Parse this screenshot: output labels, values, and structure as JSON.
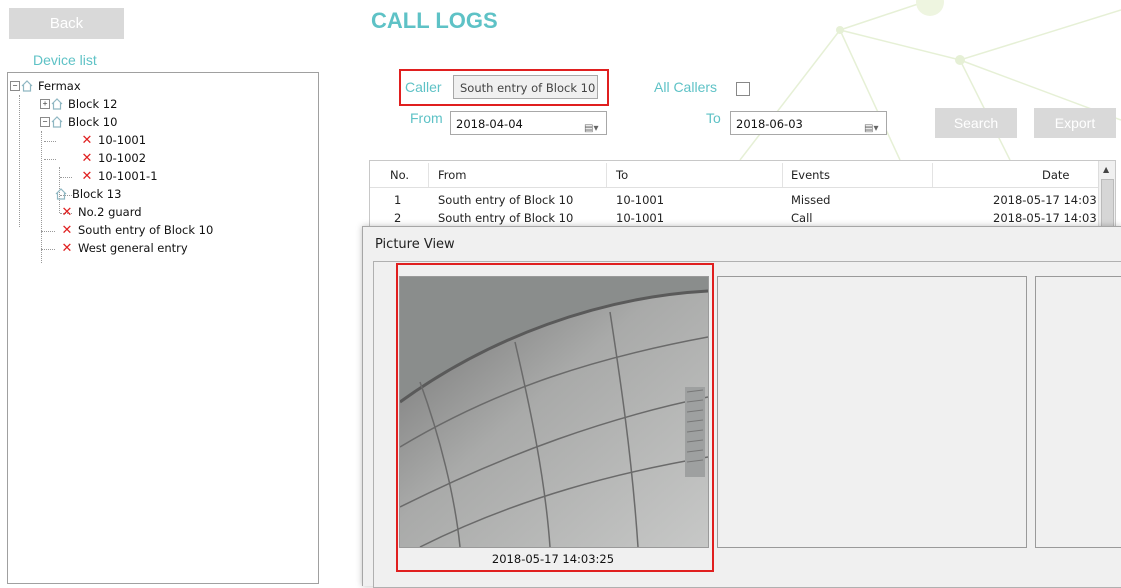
{
  "sidebar": {
    "back_label": "Back",
    "device_list_label": "Device list",
    "tree": [
      {
        "label": "Fermax",
        "icon": "house-icon",
        "expander": "−"
      },
      {
        "label": "Block 12",
        "icon": "house-icon",
        "expander": "+"
      },
      {
        "label": "Block 10",
        "icon": "house-icon",
        "expander": "−"
      },
      {
        "label": "10-1001",
        "icon": "offline-x-icon"
      },
      {
        "label": "10-1002",
        "icon": "offline-x-icon"
      },
      {
        "label": "10-1001-1",
        "icon": "offline-x-icon"
      },
      {
        "label": "Block 13",
        "icon": "house-icon"
      },
      {
        "label": "No.2 guard",
        "icon": "offline-x-icon"
      },
      {
        "label": "South entry of Block 10",
        "icon": "offline-x-icon"
      },
      {
        "label": "West general entry",
        "icon": "offline-x-icon"
      }
    ]
  },
  "header": {
    "title": "CALL LOGS"
  },
  "filters": {
    "caller_label": "Caller",
    "caller_value": "South entry of Block 10",
    "all_callers_label": "All Callers",
    "all_callers_checked": false,
    "from_label": "From",
    "from_value": "2018-04-04",
    "to_label": "To",
    "to_value": "2018-06-03",
    "search_label": "Search",
    "export_label": "Export"
  },
  "table": {
    "headers": [
      "No.",
      "From",
      "To",
      "Events",
      "Date"
    ],
    "rows": [
      [
        "1",
        "South entry of Block 10",
        "10-1001",
        "Missed",
        "2018-05-17 14:03"
      ],
      [
        "2",
        "South entry of Block 10",
        "10-1001",
        "Call",
        "2018-05-17 14:03"
      ]
    ]
  },
  "picture_view": {
    "title": "Picture View",
    "thumbnails": [
      {
        "timestamp": "2018-05-17 14:03:25"
      },
      {
        "timestamp": ""
      },
      {
        "timestamp": ""
      }
    ]
  },
  "colors": {
    "accent": "#5ec2c6",
    "highlight": "#e01f1f",
    "button_gray": "#d9d9d9"
  }
}
